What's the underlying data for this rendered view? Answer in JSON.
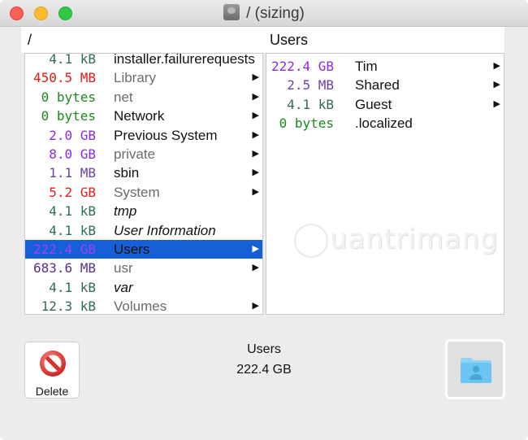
{
  "window": {
    "title": "/ (sizing)",
    "title_icon": "hard-disk-icon",
    "traffic_lights": [
      "close",
      "minimize",
      "maximize"
    ]
  },
  "columns": {
    "left": {
      "title": "/",
      "rows": [
        {
          "size": "4.1 kB",
          "size_color": "#2f6a5a",
          "name": "installer.failurerequests",
          "style": "normal",
          "has_children": false
        },
        {
          "size": "450.5 MB",
          "size_color": "#e8191a",
          "name": "Library",
          "style": "dim",
          "has_children": true
        },
        {
          "size": "0 bytes",
          "size_color": "#1a8a1a",
          "name": "net",
          "style": "dim",
          "has_children": true
        },
        {
          "size": "0 bytes",
          "size_color": "#1a8a1a",
          "name": "Network",
          "style": "normal",
          "has_children": true
        },
        {
          "size": "2.0 GB",
          "size_color": "#8a2be2",
          "name": "Previous System",
          "style": "normal",
          "has_children": true
        },
        {
          "size": "8.0 GB",
          "size_color": "#8a2be2",
          "name": "private",
          "style": "dim",
          "has_children": true
        },
        {
          "size": "1.1 MB",
          "size_color": "#6a3fa8",
          "name": "sbin",
          "style": "normal",
          "has_children": true
        },
        {
          "size": "5.2 GB",
          "size_color": "#e8191a",
          "name": "System",
          "style": "dim",
          "has_children": true
        },
        {
          "size": "4.1 kB",
          "size_color": "#2f6a5a",
          "name": "tmp",
          "style": "italic",
          "has_children": false
        },
        {
          "size": "4.1 kB",
          "size_color": "#2f6a5a",
          "name": "User Information",
          "style": "italic",
          "has_children": false
        },
        {
          "size": "222.4 GB",
          "size_color": "#a040ff",
          "name": "Users",
          "style": "normal",
          "has_children": true,
          "selected": true
        },
        {
          "size": "683.6 MB",
          "size_color": "#5a2f8a",
          "name": "usr",
          "style": "dim",
          "has_children": true
        },
        {
          "size": "4.1 kB",
          "size_color": "#2f6a5a",
          "name": "var",
          "style": "italic",
          "has_children": false
        },
        {
          "size": "12.3 kB",
          "size_color": "#2f6a5a",
          "name": "Volumes",
          "style": "dim",
          "has_children": true
        }
      ]
    },
    "right": {
      "title": "Users",
      "rows": [
        {
          "size": "222.4 GB",
          "size_color": "#8a2be2",
          "name": "Tim",
          "style": "normal",
          "has_children": true
        },
        {
          "size": "2.5 MB",
          "size_color": "#6a3fa8",
          "name": "Shared",
          "style": "normal",
          "has_children": true
        },
        {
          "size": "4.1 kB",
          "size_color": "#2f6a5a",
          "name": "Guest",
          "style": "normal",
          "has_children": true
        },
        {
          "size": "0 bytes",
          "size_color": "#1a8a1a",
          "name": ".localized",
          "style": "normal",
          "has_children": false
        }
      ]
    }
  },
  "footer": {
    "delete_label": "Delete",
    "selected_name": "Users",
    "selected_size": "222.4 GB",
    "reveal_icon": "user-folder-icon"
  },
  "watermark": "uantrimang"
}
